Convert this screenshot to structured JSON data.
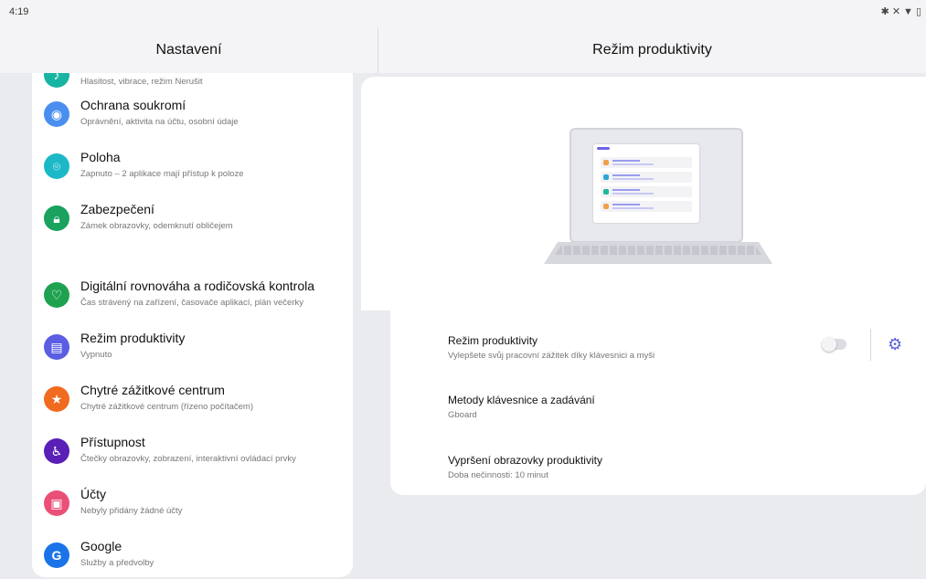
{
  "status": {
    "time": "4:19",
    "icons": [
      "bluetooth-icon",
      "mute-icon",
      "wifi-icon",
      "battery-icon"
    ]
  },
  "header": {
    "left_title": "Nastavení",
    "right_title": "Režim produktivity"
  },
  "sidebar": {
    "items": [
      {
        "title": "",
        "sub": "Hlasitost, vibrace, režim Nerušit",
        "icon": "sound-icon",
        "color": "#17b4a2"
      },
      {
        "title": "Ochrana soukromí",
        "sub": "Oprávnění, aktivita na účtu, osobní údaje",
        "icon": "privacy-eye-icon",
        "color": "#4a8ff0"
      },
      {
        "title": "Poloha",
        "sub": "Zapnuto – 2 aplikace mají přístup k poloze",
        "icon": "location-icon",
        "color": "#1cb8c8"
      },
      {
        "title": "Zabezpečení",
        "sub": "Zámek obrazovky, odemknutí obličejem",
        "icon": "lock-icon",
        "color": "#1aa25f"
      },
      {
        "title": "Digitální rovnováha a rodičovská kontrola",
        "sub": "Čas strávený na zařízení, časovače aplikací, plán večerky",
        "icon": "digital-wellbeing-icon",
        "color": "#1fa24f"
      },
      {
        "title": "Režim produktivity",
        "sub": "Vypnuto",
        "icon": "productivity-icon",
        "color": "#5b5ee2"
      },
      {
        "title": "Chytré zážitkové centrum",
        "sub": "Chytré zážitkové centrum (řízeno počítačem)",
        "icon": "star-icon",
        "color": "#f06a1f"
      },
      {
        "title": "Přístupnost",
        "sub": "Čtečky obrazovky, zobrazení, interaktivní ovládací prvky",
        "icon": "accessibility-icon",
        "color": "#5a1fb6"
      },
      {
        "title": "Účty",
        "sub": "Nebyly přidány žádné účty",
        "icon": "accounts-icon",
        "color": "#ea4f78"
      },
      {
        "title": "Google",
        "sub": "Služby a předvolby",
        "icon": "google-icon",
        "color": "#1a73e8"
      }
    ]
  },
  "detail": {
    "settings": [
      {
        "title": "Režim produktivity",
        "sub": "Vylepšete svůj pracovní zážitek díky klávesnici a myši"
      },
      {
        "title": "Metody klávesnice a zadávání",
        "sub": "Gboard"
      },
      {
        "title": "Vypršení obrazovky produktivity",
        "sub": "Doba nečinnosti: 10 minut"
      }
    ],
    "toggle_on": false
  }
}
